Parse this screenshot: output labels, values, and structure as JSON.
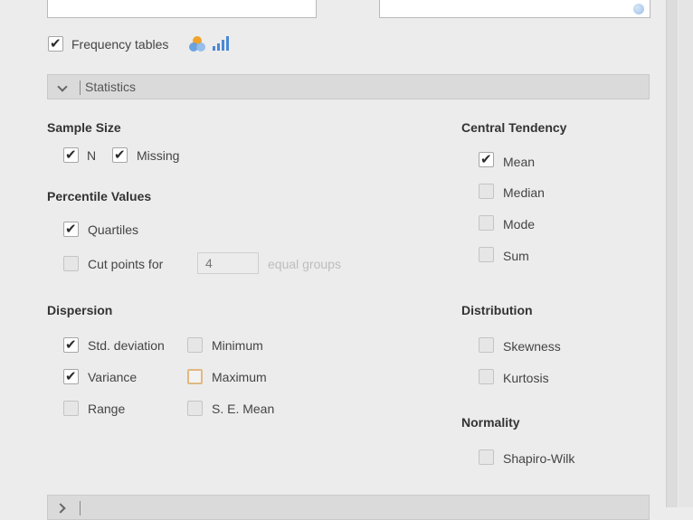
{
  "frequency_tables": {
    "label": "Frequency tables",
    "checked": true
  },
  "statistics_section": {
    "label": "Statistics"
  },
  "sample_size": {
    "heading": "Sample Size",
    "n": {
      "label": "N",
      "checked": true
    },
    "missing": {
      "label": "Missing",
      "checked": true
    }
  },
  "percentile_values": {
    "heading": "Percentile Values",
    "quartiles": {
      "label": "Quartiles",
      "checked": true
    },
    "cut_points": {
      "label": "Cut points for",
      "checked": false,
      "value": "4",
      "suffix": "equal groups"
    }
  },
  "dispersion": {
    "heading": "Dispersion",
    "std_deviation": {
      "label": "Std. deviation",
      "checked": true
    },
    "variance": {
      "label": "Variance",
      "checked": true
    },
    "range": {
      "label": "Range",
      "checked": false
    },
    "minimum": {
      "label": "Minimum",
      "checked": false
    },
    "maximum": {
      "label": "Maximum",
      "checked": false
    },
    "se_mean": {
      "label": "S. E. Mean",
      "checked": false
    }
  },
  "central_tendency": {
    "heading": "Central Tendency",
    "mean": {
      "label": "Mean",
      "checked": true
    },
    "median": {
      "label": "Median",
      "checked": false
    },
    "mode": {
      "label": "Mode",
      "checked": false
    },
    "sum": {
      "label": "Sum",
      "checked": false
    }
  },
  "distribution": {
    "heading": "Distribution",
    "skewness": {
      "label": "Skewness",
      "checked": false
    },
    "kurtosis": {
      "label": "Kurtosis",
      "checked": false
    }
  },
  "normality": {
    "heading": "Normality",
    "shapiro_wilk": {
      "label": "Shapiro-Wilk",
      "checked": false
    }
  },
  "icons": [
    "venn-icon",
    "bar-chart-icon",
    "chevron-down-icon",
    "chevron-right-icon"
  ]
}
